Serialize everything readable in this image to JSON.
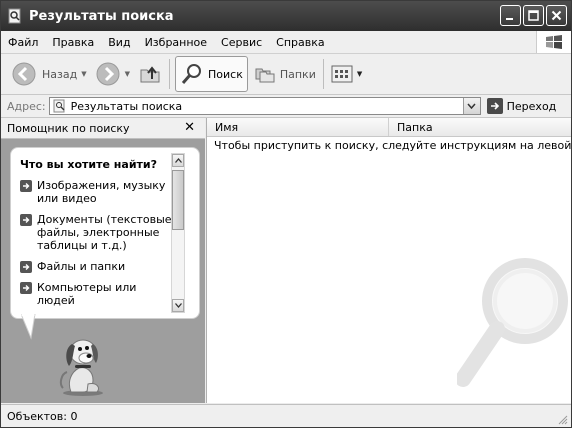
{
  "window": {
    "title": "Результаты поиска"
  },
  "menubar": {
    "items": [
      "Файл",
      "Правка",
      "Вид",
      "Избранное",
      "Сервис",
      "Справка"
    ]
  },
  "toolbar": {
    "back_label": "Назад",
    "search_label": "Поиск",
    "folders_label": "Папки"
  },
  "address": {
    "label": "Адрес:",
    "value": "Результаты поиска",
    "go_label": "Переход"
  },
  "assistant": {
    "title": "Помощник по поиску",
    "heading": "Что вы хотите найти?",
    "options": [
      "Изображения, музыку или видео",
      "Документы (текстовые файлы, электронные таблицы и т.д.)",
      "Файлы и папки",
      "Компьютеры или людей"
    ]
  },
  "results": {
    "columns": [
      "Имя",
      "Папка"
    ],
    "hint": "Чтобы приступить к поиску, следуйте инструкциям на левой панели."
  },
  "status": {
    "text": "Объектов: 0"
  }
}
